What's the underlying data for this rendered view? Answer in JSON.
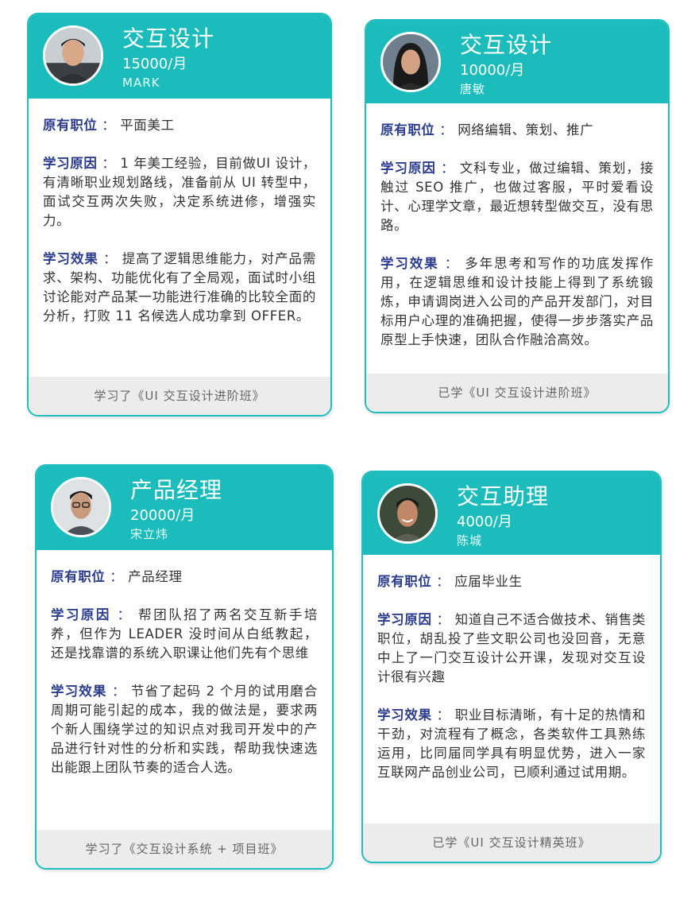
{
  "cards": [
    {
      "title": "交互设计",
      "salary": "15000/月",
      "name": "MARK",
      "avatar": "avatar-photo-young-man",
      "position_label": "原有职位",
      "position_value": "平面美工",
      "reason_label": "学习原因",
      "reason_value": "1 年美工经验，目前做UI 设计，有清晰职业规划路线，准备前从 UI 转型中，面试交互两次失败，决定系统进修，增强实力。",
      "effect_label": "学习效果",
      "effect_value": "提高了逻辑思维能力，对产品需求、架构、功能优化有了全局观，面试时小组讨论能对产品某一功能进行准确的比较全面的分析，打败 11 名候选人成功拿到 OFFER。",
      "footer": "学习了《UI 交互设计进阶班》"
    },
    {
      "title": "交互设计",
      "salary": "10000/月",
      "name": "唐敏",
      "avatar": "avatar-photo-woman",
      "position_label": "原有职位",
      "position_value": "网络编辑、策划、推广",
      "reason_label": "学习原因",
      "reason_value": "文科专业，做过编辑、策划，接触过 SEO 推广，也做过客服，平时爱看设计、心理学文章，最近想转型做交互，没有思路。",
      "effect_label": "学习效果",
      "effect_value": "多年思考和写作的功底发挥作用，在逻辑思维和设计技能上得到了系统锻炼，申请调岗进入公司的产品开发部门，对目标用户心理的准确把握，使得一步步落实产品原型上手快速，团队合作融洽高效。",
      "footer": "已学《UI 交互设计进阶班》"
    },
    {
      "title": "产品经理",
      "salary": "20000/月",
      "name": "宋立炜",
      "avatar": "avatar-photo-man-glasses",
      "position_label": "原有职位",
      "position_value": "产品经理",
      "reason_label": "学习原因",
      "reason_value": "帮团队招了两名交互新手培养，但作为 LEADER 没时间从白纸教起，还是找靠谱的系统入职课让他们先有个思维",
      "effect_label": "学习效果",
      "effect_value": "节省了起码 2 个月的试用磨合周期可能引起的成本，我的做法是，要求两个新人围绕学过的知识点对我司开发中的产品进行针对性的分析和实践，帮助我快速选出能跟上团队节奏的适合人选。",
      "footer": "学习了《交互设计系统 + 项目班》"
    },
    {
      "title": "交互助理",
      "salary": "4000/月",
      "name": "陈城",
      "avatar": "avatar-photo-man-smiling",
      "position_label": "原有职位",
      "position_value": "应届毕业生",
      "reason_label": "学习原因",
      "reason_value": "知道自己不适合做技术、销售类职位，胡乱投了些文职公司也没回音，无意中上了一门交互设计公开课，发现对交互设计很有兴趣",
      "effect_label": "学习效果",
      "effect_value": "职业目标清晰，有十足的热情和干劲，对流程有了概念，各类软件工具熟练运用，比同届同学具有明显优势，进入一家互联网产品创业公司，已顺利通过试用期。",
      "footer": "已学《UI 交互设计精英班》"
    }
  ],
  "colors": {
    "header": "#1bbcbb",
    "border": "#1fbdbe",
    "label": "#2b3d8c",
    "footer_bg": "#ececec"
  }
}
